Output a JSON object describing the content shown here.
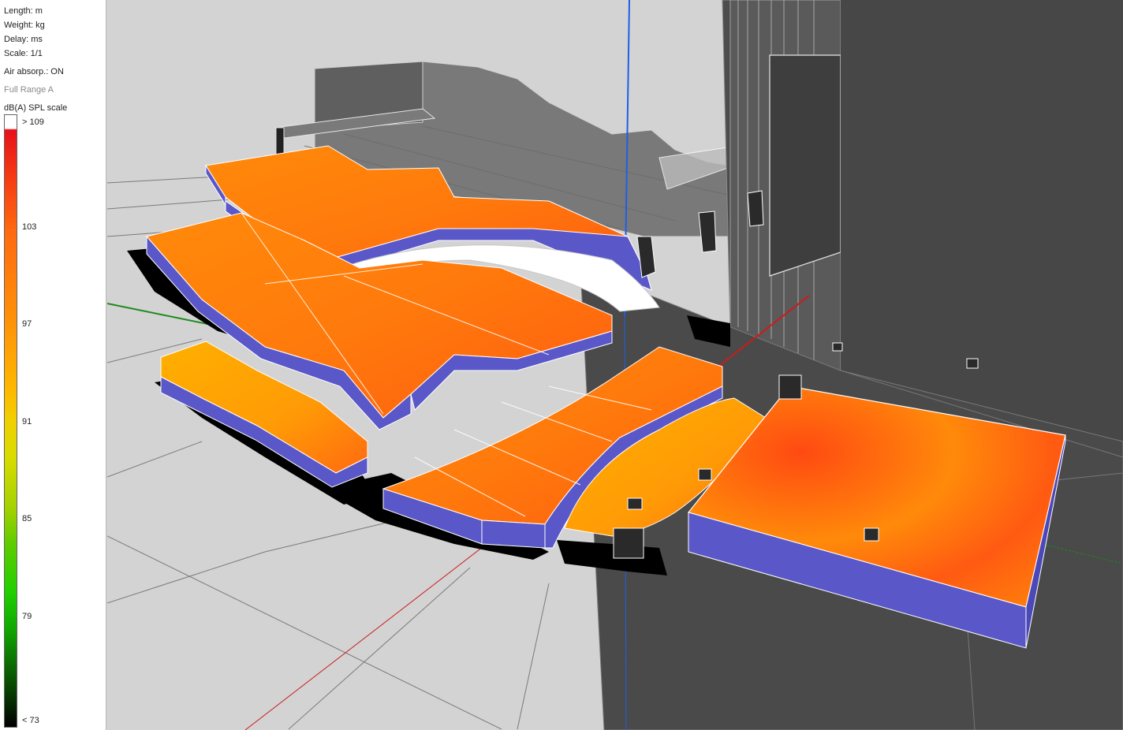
{
  "units": {
    "length": "Length: m",
    "weight": "Weight: kg",
    "delay": "Delay: ms",
    "scale": "Scale: 1/1"
  },
  "air_absorption": "Air absorp.: ON",
  "band": "Full Range A",
  "spl_scale": {
    "title": "dB(A) SPL scale",
    "ticks": [
      "> 109",
      "103",
      "97",
      "91",
      "85",
      "79",
      "< 73"
    ]
  },
  "colors": {
    "background": "#d3d3d3",
    "floor": "#4a4a4a",
    "structure": "#555555",
    "side_faces": "#5a57c8",
    "spl_high": "#ff3a10",
    "spl_mid": "#ff8c0a",
    "spl_low": "#ffc000",
    "axis_x": "#cc1b1b",
    "axis_y": "#1e8a1e",
    "axis_z": "#1e5fe6"
  },
  "icons": {
    "speaker_array": "speaker-array-icon",
    "subwoofer": "subwoofer-icon",
    "fill_speaker": "speaker-icon"
  }
}
